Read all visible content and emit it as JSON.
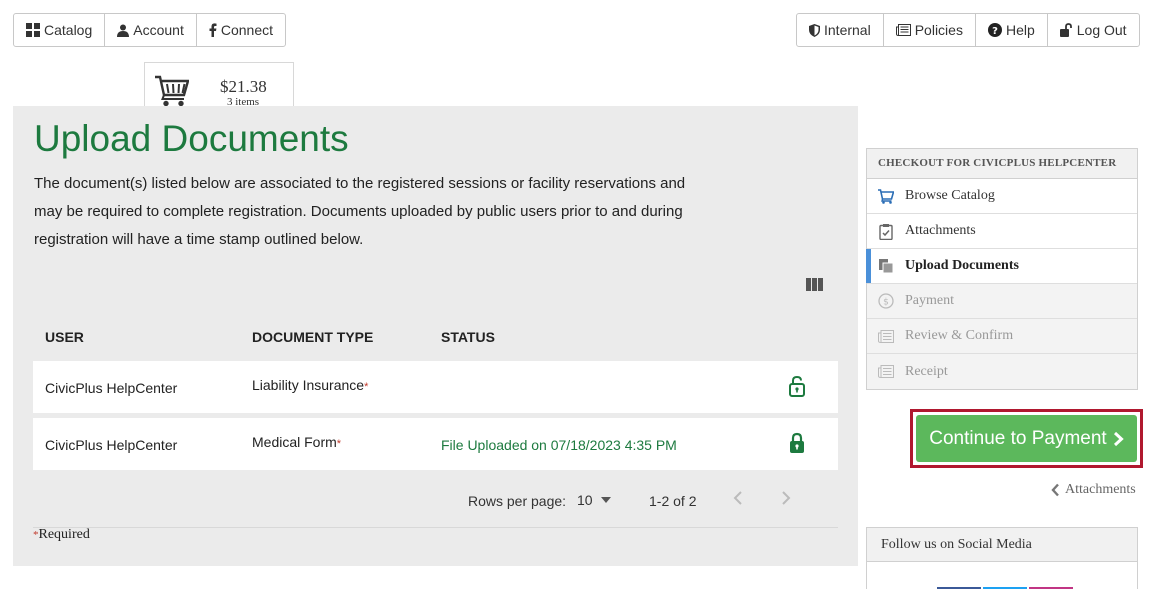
{
  "nav_left": [
    {
      "label": "Catalog",
      "icon": "grid-icon"
    },
    {
      "label": "Account",
      "icon": "user-icon"
    },
    {
      "label": "Connect",
      "icon": "facebook-icon"
    }
  ],
  "nav_right": [
    {
      "label": "Internal",
      "icon": "shield-icon"
    },
    {
      "label": "Policies",
      "icon": "newspaper-icon"
    },
    {
      "label": "Help",
      "icon": "question-circle-icon"
    },
    {
      "label": "Log Out",
      "icon": "unlock-icon"
    }
  ],
  "cart": {
    "amount": "$21.38",
    "items": "3 items"
  },
  "page": {
    "title": "Upload Documents",
    "intro": "The document(s) listed below are associated to the registered sessions or facility reservations and may be required to complete registration. Documents uploaded by public users prior to and during registration will have a time stamp outlined below."
  },
  "table": {
    "headers": {
      "user": "USER",
      "doc_type": "DOCUMENT TYPE",
      "status": "STATUS"
    },
    "rows": [
      {
        "user": "CivicPlus HelpCenter",
        "doc_type": "Liability Insurance",
        "required_mark": "*",
        "status": "",
        "lock": "unlock-icon"
      },
      {
        "user": "CivicPlus HelpCenter",
        "doc_type": "Medical Form",
        "required_mark": "*",
        "status": "File Uploaded on 07/18/2023 4:35 PM",
        "lock": "lock-icon"
      }
    ]
  },
  "pager": {
    "rows_per_page_label": "Rows per page:",
    "rows_per_page": "10",
    "range": "1-2 of 2"
  },
  "required_note": {
    "mark": "*",
    "text": "Required"
  },
  "checkout": {
    "header": "CHECKOUT FOR CIVICPLUS HELPCENTER",
    "steps": [
      {
        "label": "Browse Catalog",
        "icon": "cart-icon",
        "state": "link"
      },
      {
        "label": "Attachments",
        "icon": "clipboard-check-icon",
        "state": "link"
      },
      {
        "label": "Upload Documents",
        "icon": "documents-icon",
        "state": "active"
      },
      {
        "label": "Payment",
        "icon": "dollar-circle-icon",
        "state": "disabled"
      },
      {
        "label": "Review & Confirm",
        "icon": "newspaper-icon",
        "state": "disabled"
      },
      {
        "label": "Receipt",
        "icon": "newspaper-icon",
        "state": "disabled"
      }
    ]
  },
  "continue_button": {
    "label": "Continue to Payment"
  },
  "back_link": {
    "label": "Attachments"
  },
  "social": {
    "header": "Follow us on Social Media"
  },
  "colors": {
    "title_green": "#1d7a3f",
    "button_green": "#5cb85c",
    "highlight_border": "#b0182f",
    "active_step_bar": "#4a90d9",
    "required_red": "#c0392b"
  }
}
